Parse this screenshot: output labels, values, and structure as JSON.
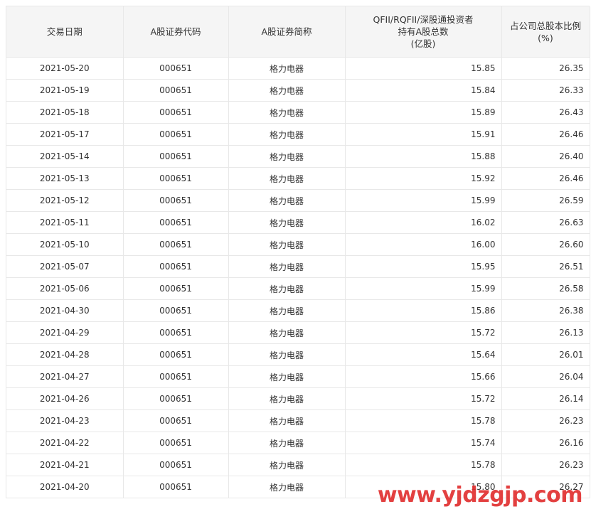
{
  "table": {
    "headers": {
      "date": "交易日期",
      "code": "A股证券代码",
      "name": "A股证券简称",
      "holding_line1": "QFII/RQFII/深股通投资者",
      "holding_line2": "持有A股总数",
      "holding_line3": "(亿股)",
      "ratio_line1": "占公司总股本比例",
      "ratio_line2": "(%)"
    },
    "rows": [
      {
        "date": "2021-05-20",
        "code": "000651",
        "name": "格力电器",
        "holding": "15.85",
        "ratio": "26.35"
      },
      {
        "date": "2021-05-19",
        "code": "000651",
        "name": "格力电器",
        "holding": "15.84",
        "ratio": "26.33"
      },
      {
        "date": "2021-05-18",
        "code": "000651",
        "name": "格力电器",
        "holding": "15.89",
        "ratio": "26.43"
      },
      {
        "date": "2021-05-17",
        "code": "000651",
        "name": "格力电器",
        "holding": "15.91",
        "ratio": "26.46"
      },
      {
        "date": "2021-05-14",
        "code": "000651",
        "name": "格力电器",
        "holding": "15.88",
        "ratio": "26.40"
      },
      {
        "date": "2021-05-13",
        "code": "000651",
        "name": "格力电器",
        "holding": "15.92",
        "ratio": "26.46"
      },
      {
        "date": "2021-05-12",
        "code": "000651",
        "name": "格力电器",
        "holding": "15.99",
        "ratio": "26.59"
      },
      {
        "date": "2021-05-11",
        "code": "000651",
        "name": "格力电器",
        "holding": "16.02",
        "ratio": "26.63"
      },
      {
        "date": "2021-05-10",
        "code": "000651",
        "name": "格力电器",
        "holding": "16.00",
        "ratio": "26.60"
      },
      {
        "date": "2021-05-07",
        "code": "000651",
        "name": "格力电器",
        "holding": "15.95",
        "ratio": "26.51"
      },
      {
        "date": "2021-05-06",
        "code": "000651",
        "name": "格力电器",
        "holding": "15.99",
        "ratio": "26.58"
      },
      {
        "date": "2021-04-30",
        "code": "000651",
        "name": "格力电器",
        "holding": "15.86",
        "ratio": "26.38"
      },
      {
        "date": "2021-04-29",
        "code": "000651",
        "name": "格力电器",
        "holding": "15.72",
        "ratio": "26.13"
      },
      {
        "date": "2021-04-28",
        "code": "000651",
        "name": "格力电器",
        "holding": "15.64",
        "ratio": "26.01"
      },
      {
        "date": "2021-04-27",
        "code": "000651",
        "name": "格力电器",
        "holding": "15.66",
        "ratio": "26.04"
      },
      {
        "date": "2021-04-26",
        "code": "000651",
        "name": "格力电器",
        "holding": "15.72",
        "ratio": "26.14"
      },
      {
        "date": "2021-04-23",
        "code": "000651",
        "name": "格力电器",
        "holding": "15.78",
        "ratio": "26.23"
      },
      {
        "date": "2021-04-22",
        "code": "000651",
        "name": "格力电器",
        "holding": "15.74",
        "ratio": "26.16"
      },
      {
        "date": "2021-04-21",
        "code": "000651",
        "name": "格力电器",
        "holding": "15.78",
        "ratio": "26.23"
      },
      {
        "date": "2021-04-20",
        "code": "000651",
        "name": "格力电器",
        "holding": "15.80",
        "ratio": "26.27"
      }
    ]
  },
  "watermark": {
    "text": "www.yjdzgjp.com",
    "color": "#e02c2c"
  }
}
